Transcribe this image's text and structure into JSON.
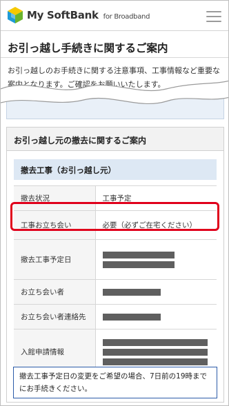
{
  "header": {
    "brand": "My SoftBank",
    "brand_sub": "for Broadband",
    "menu_icon": "hamburger-menu-icon"
  },
  "page": {
    "title": "お引っ越し手続きに関するご案内",
    "intro": "お引っ越しのお手続きに関する注意事項、工事情報など重要な案内となります。ご確認をお願いいたします。"
  },
  "section": {
    "title": "お引っ越し元の撤去に関するご案内",
    "subheading": "撤去工事（お引っ越し元）",
    "rows": [
      {
        "label": "撤去状況",
        "value": "工事予定"
      },
      {
        "label": "工事お立ち会い",
        "value": "必要（必ずご在宅ください）"
      },
      {
        "label": "撤去工事予定日",
        "value": ""
      },
      {
        "label": "お立ち会い者",
        "value": ""
      },
      {
        "label": "お立ち会い者連絡先",
        "value": ""
      },
      {
        "label": "入館申請情報",
        "value": ""
      }
    ]
  },
  "notice": "撤去工事予定日の変更をご希望の場合、7日前の19時までにお手続きください。",
  "colors": {
    "highlight": "#e0001b",
    "notice_border": "#2a5aa8",
    "subheading_bg": "#dde8f4"
  }
}
